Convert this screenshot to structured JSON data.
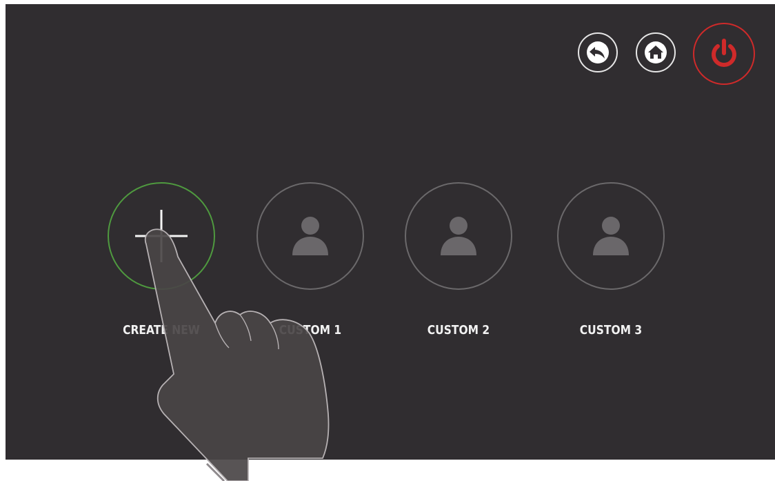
{
  "toolbar": {
    "back": {
      "icon": "back-arrow-icon"
    },
    "home": {
      "icon": "home-icon"
    },
    "power": {
      "icon": "power-icon",
      "color": "#cf2a2a"
    }
  },
  "profiles": [
    {
      "label": "CREATE NEW",
      "icon": "plus-icon",
      "accent": "#4f9a3f"
    },
    {
      "label": "CUSTOM 1",
      "icon": "user-icon"
    },
    {
      "label": "CUSTOM 2",
      "icon": "user-icon"
    },
    {
      "label": "CUSTOM 3",
      "icon": "user-icon"
    }
  ],
  "colors": {
    "background": "#302d30",
    "ring": "#6b696b",
    "user_icon": "#6a676a",
    "hand_fill": "#4a4547"
  }
}
